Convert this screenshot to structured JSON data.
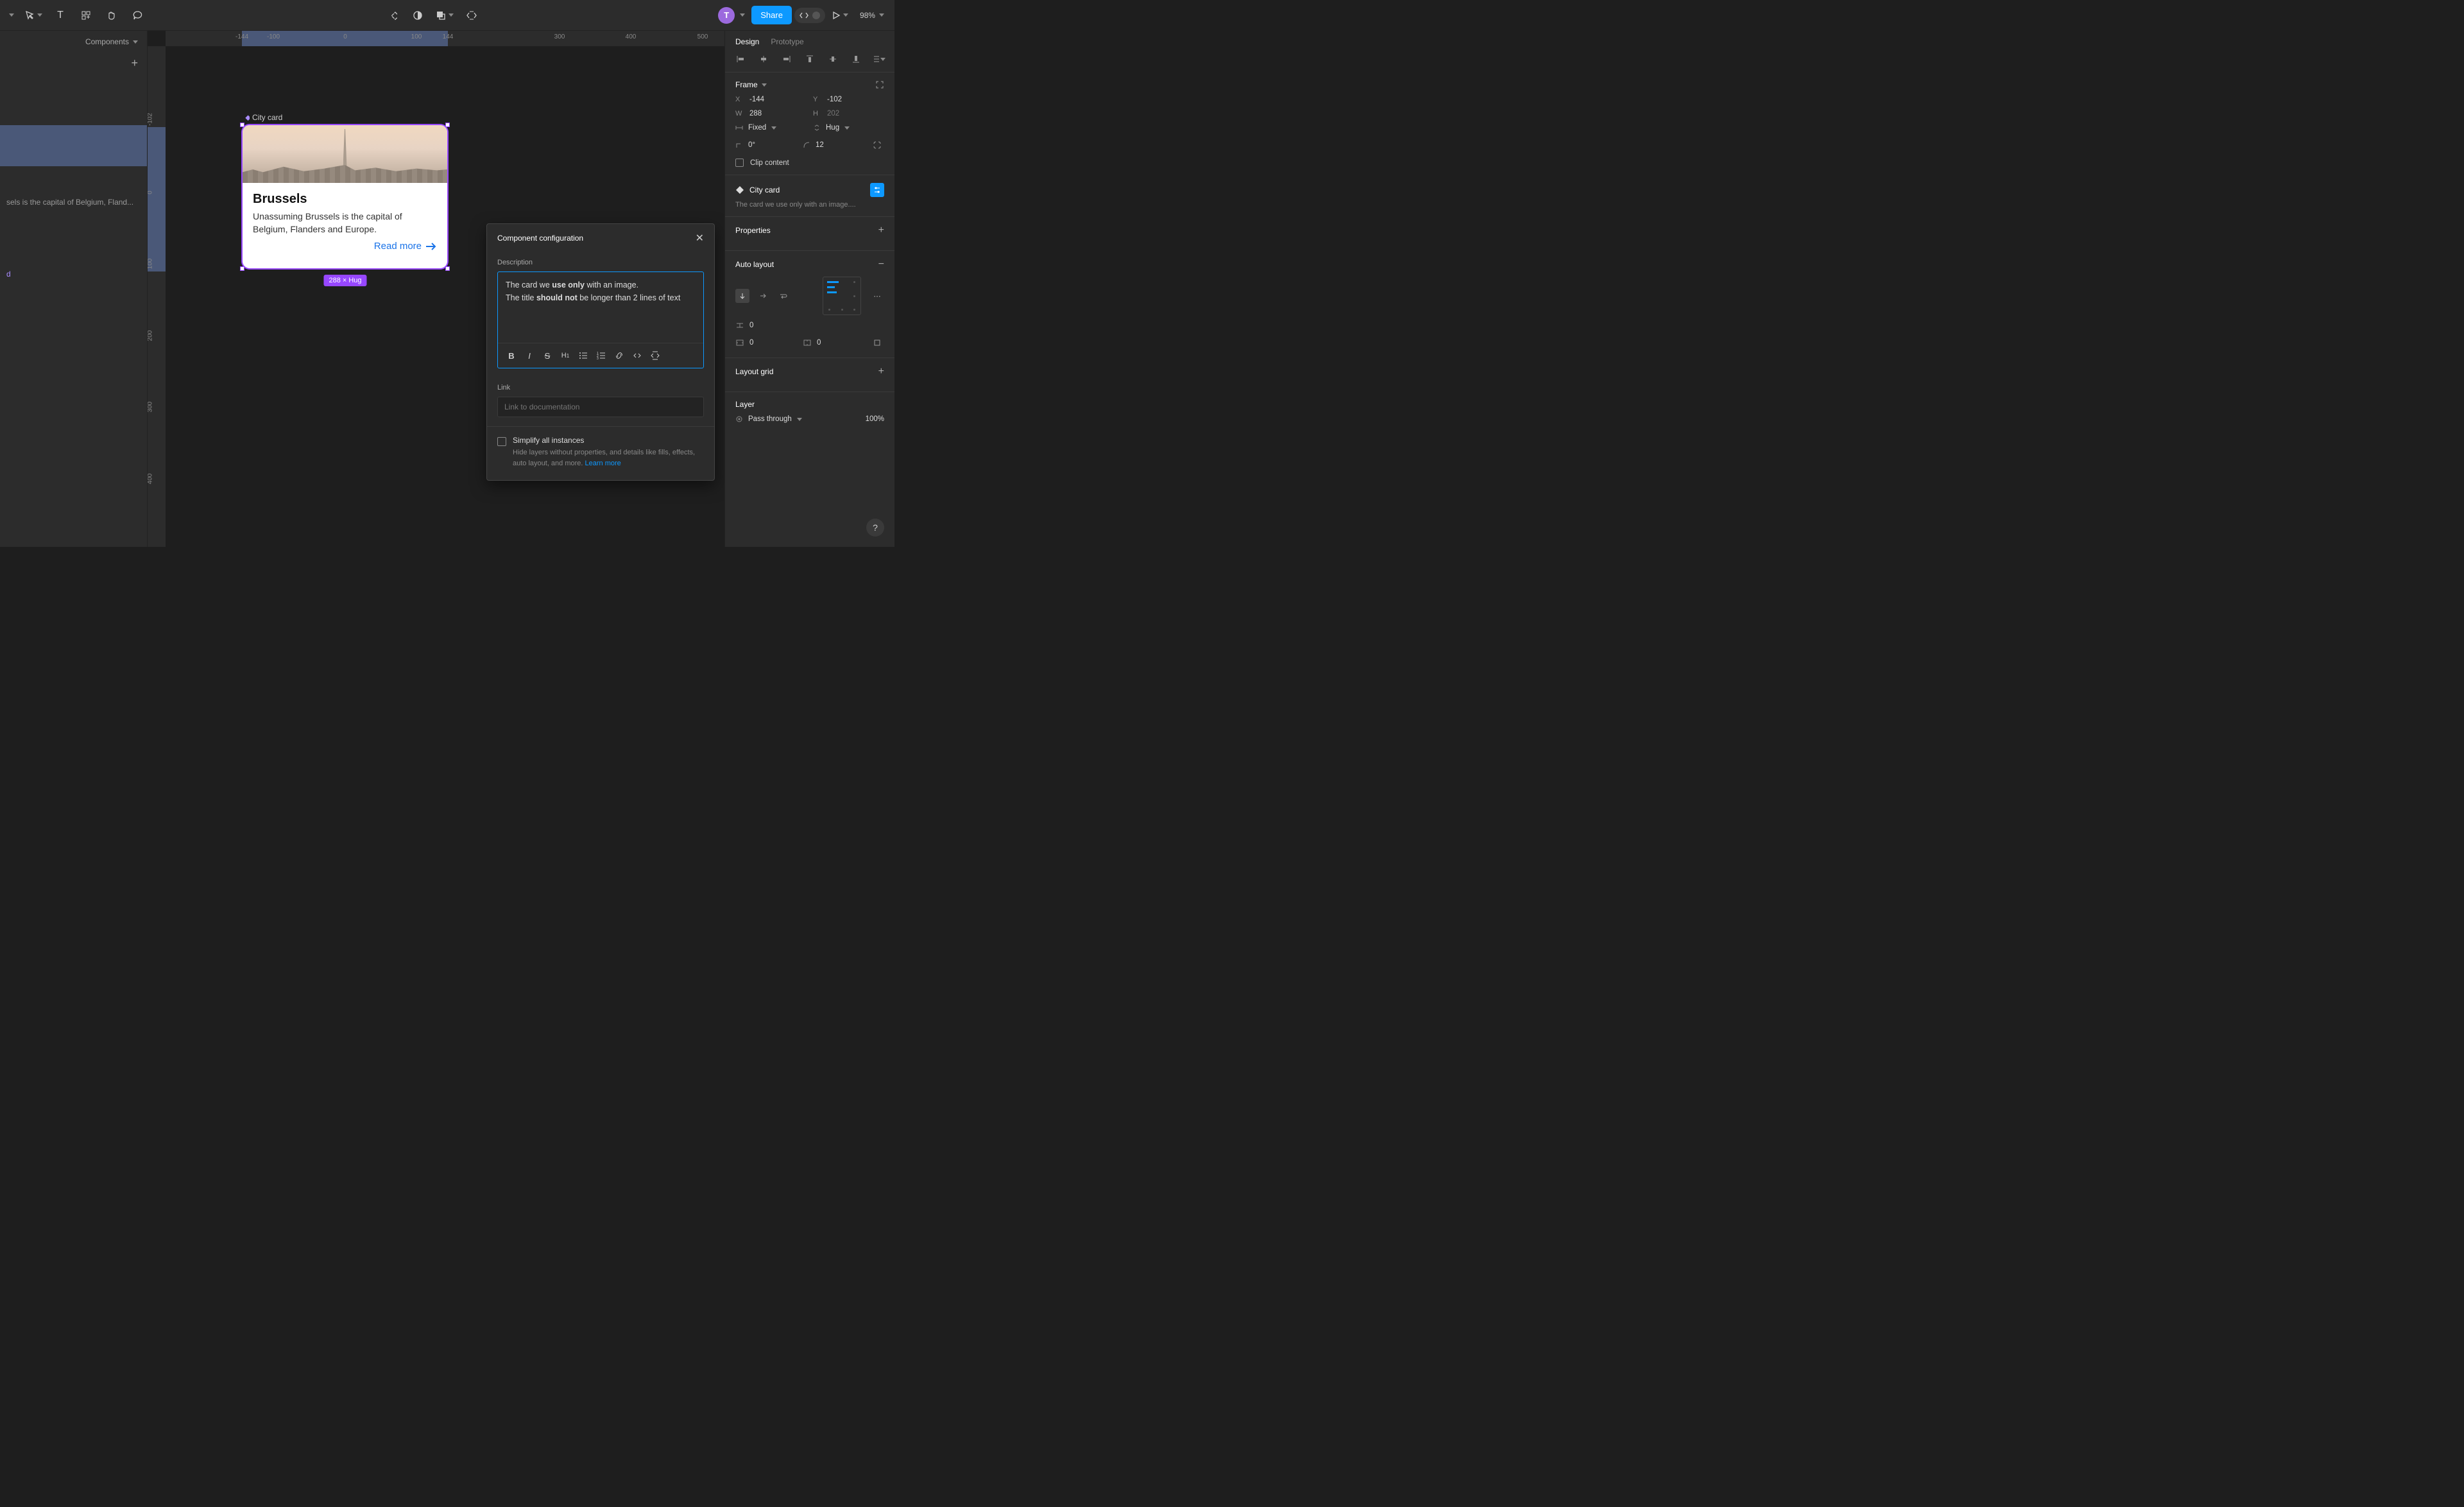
{
  "toolbar": {
    "avatar_letter": "T",
    "share_label": "Share",
    "zoom": "98%"
  },
  "left_panel": {
    "header": "Components",
    "truncated_text_row": "sels is the capital of Belgium, Fland...",
    "truncated_component_row": "d"
  },
  "rulers": {
    "top": [
      "-144",
      "-100",
      "0",
      "100",
      "144",
      "300",
      "400",
      "500"
    ],
    "left": [
      "-102",
      "0",
      "100",
      "200",
      "300",
      "400"
    ]
  },
  "canvas": {
    "frame_label": "City card",
    "card_title": "Brussels",
    "card_body": "Unassuming Brussels is the capital of Belgium, Flanders and Europe.",
    "card_link": "Read more",
    "dim_badge": "288 × Hug"
  },
  "popover": {
    "title": "Component configuration",
    "desc_label": "Description",
    "desc_line1_pre": "The card we ",
    "desc_line1_b": "use only",
    "desc_line1_post": " with an image.",
    "desc_line2_pre": "The title ",
    "desc_line2_b": "should not",
    "desc_line2_post": " be longer than 2 lines of text",
    "link_label": "Link",
    "link_placeholder": "Link to documentation",
    "simplify_label": "Simplify all instances",
    "simplify_help": "Hide layers without properties, and details like fills, effects, auto layout, and more. ",
    "learn_more": "Learn more"
  },
  "right_panel": {
    "tab_design": "Design",
    "tab_prototype": "Prototype",
    "frame_section": "Frame",
    "x": "-144",
    "y": "-102",
    "w": "288",
    "h": "202",
    "w_mode": "Fixed",
    "h_mode": "Hug",
    "rotation": "0°",
    "radius": "12",
    "clip_content": "Clip content",
    "component_name": "City card",
    "component_desc": "The card we use only with an image....",
    "properties_section": "Properties",
    "autolayout_section": "Auto layout",
    "gap_v": "0",
    "pad_h": "0",
    "pad_v": "0",
    "layoutgrid_section": "Layout grid",
    "layer_section": "Layer",
    "blend_mode": "Pass through",
    "opacity": "100%"
  }
}
